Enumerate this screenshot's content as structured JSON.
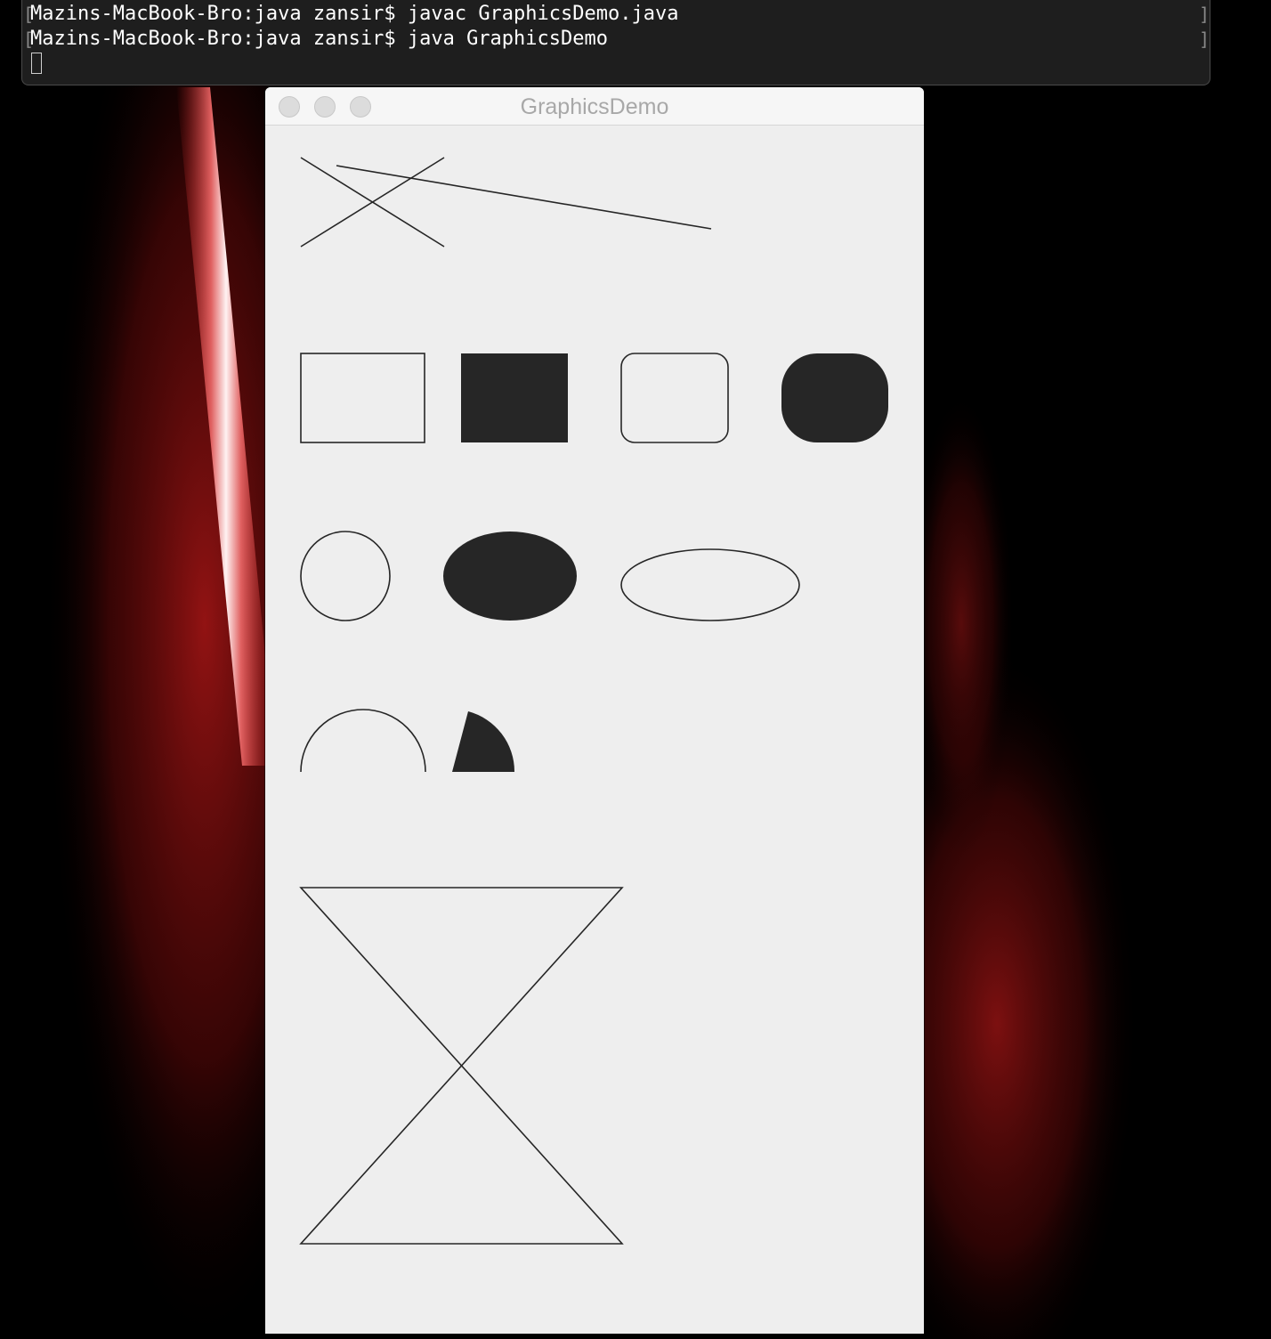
{
  "terminal": {
    "lines": [
      "Mazins-MacBook-Bro:java zansir$ javac GraphicsDemo.java",
      "Mazins-MacBook-Bro:java zansir$ java GraphicsDemo"
    ]
  },
  "window": {
    "title": "GraphicsDemo"
  },
  "colors": {
    "canvas_bg": "#eeeeee",
    "stroke": "#262626",
    "fill": "#262626",
    "desktop_red": "#8b0f0f"
  }
}
